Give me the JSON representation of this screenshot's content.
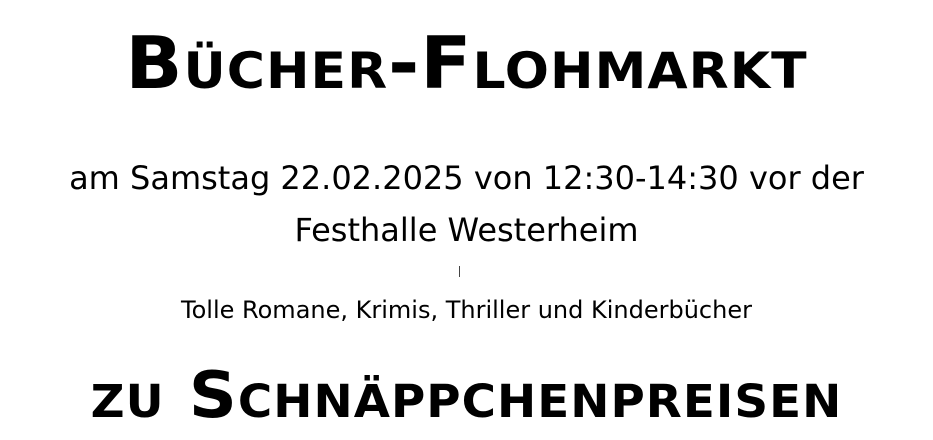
{
  "document": {
    "headline": "Bücher-Flohmarkt",
    "line1": "am Samstag 22.02.2025 von 12:30-14:30 vor der",
    "line2": "Festhalle Westerheim",
    "tagline": "Tolle Romane, Krimis, Thriller und Kinderbücher",
    "closing": "zu Schnäppchenpreisen"
  }
}
